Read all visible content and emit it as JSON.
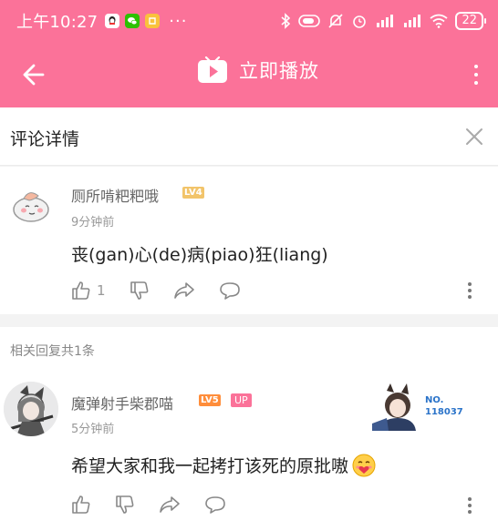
{
  "status_bar": {
    "time": "上午10:27",
    "apps": [
      "QQ",
      "WeChat",
      "Mini"
    ],
    "more": "···",
    "battery": "22"
  },
  "title_bar": {
    "play_label": "立即播放"
  },
  "detail": {
    "title": "评论详情"
  },
  "main_comment": {
    "username": "厕所啃粑粑哦",
    "level": "LV4",
    "time": "9分钟前",
    "text": "丧(gan)心(de)病(piao)狂(liang)",
    "likes": "1"
  },
  "replies": {
    "header": "相关回复共1条"
  },
  "reply_comment": {
    "username": "魔弹射手柴郡喵",
    "level": "LV5",
    "up_badge": "UP",
    "time": "5分钟前",
    "text": "希望大家和我一起拷打该死的原批嗷",
    "no_line1": "NO.",
    "no_line2": "118037"
  },
  "colors": {
    "brand_pink": "#fb7299",
    "level4": "#f2c46a",
    "level5": "#ff8d3a",
    "no_blue": "#2a73c9"
  },
  "icons": [
    "back-arrow-icon",
    "tv-play-icon",
    "more-vert-icon",
    "close-icon",
    "thumb-up-icon",
    "thumb-down-icon",
    "share-icon",
    "comment-icon",
    "kebab-icon"
  ]
}
